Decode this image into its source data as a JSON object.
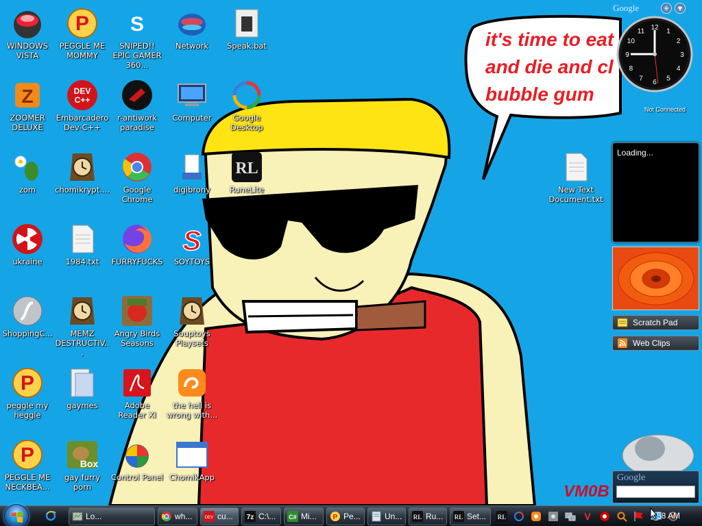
{
  "desktop_icons": [
    {
      "id": "windows-vista",
      "label": "WINDOWS VISTA",
      "icon": "vista-orb-icon"
    },
    {
      "id": "peggle-me-mommy",
      "label": "PEGGLE ME MOMMY",
      "icon": "peggle-icon"
    },
    {
      "id": "sniped",
      "label": "SNIPED!! EPIC GAMER 360...",
      "icon": "skype-icon"
    },
    {
      "id": "network",
      "label": "Network",
      "icon": "network-icon"
    },
    {
      "id": "speak-bat",
      "label": "Speak.bat",
      "icon": "batch-file-icon"
    },
    {
      "id": "zoomer-deluxe",
      "label": "ZOOMER DELUXE",
      "icon": "zoomer-icon"
    },
    {
      "id": "embarcadero",
      "label": "Embarcadero Dev-C++",
      "icon": "devcpp-icon"
    },
    {
      "id": "r-antiwork",
      "label": "r-antiwork paradise",
      "icon": "antiwork-icon"
    },
    {
      "id": "computer",
      "label": "Computer",
      "icon": "computer-icon"
    },
    {
      "id": "google-desktop",
      "label": "Google Desktop",
      "icon": "google-desktop-icon"
    },
    {
      "id": "zom",
      "label": "zom",
      "icon": "plant-icon"
    },
    {
      "id": "chomikrypt",
      "label": "chomikrypt....",
      "icon": "clock-app-icon"
    },
    {
      "id": "google-chrome",
      "label": "Google Chrome",
      "icon": "chrome-icon"
    },
    {
      "id": "digibrony",
      "label": "digibrony",
      "icon": "installer-icon"
    },
    {
      "id": "runelite",
      "label": "RuneLite",
      "icon": "runelite-icon"
    },
    {
      "id": "new-text-document",
      "label": "New Text Document.txt",
      "icon": "text-file-icon"
    },
    {
      "id": "ukraine",
      "label": "ukraine",
      "icon": "radiation-icon"
    },
    {
      "id": "1984-txt",
      "label": "1984.txt",
      "icon": "text-file-icon"
    },
    {
      "id": "furryfucks",
      "label": "FURRYFUCKS",
      "icon": "firefox-icon"
    },
    {
      "id": "soytoys",
      "label": "SOYTOYS",
      "icon": "soytoys-icon"
    },
    {
      "id": "shoppingc",
      "label": "ShoppingC...",
      "icon": "flash-icon"
    },
    {
      "id": "memz",
      "label": "MEMZ DESTRUCTIV...",
      "icon": "clock-app-icon"
    },
    {
      "id": "angry-birds",
      "label": "Angry Birds Seasons",
      "icon": "angry-birds-icon"
    },
    {
      "id": "souptoys",
      "label": "Souptoys Playsets",
      "icon": "clock-app-icon"
    },
    {
      "id": "peggle-my-heggle",
      "label": "peggle my heggle",
      "icon": "peggle-icon"
    },
    {
      "id": "gaymes",
      "label": "gaymes",
      "icon": "games-folder-icon"
    },
    {
      "id": "adobe-reader",
      "label": "Adobe Reader XI",
      "icon": "adobe-reader-icon"
    },
    {
      "id": "the-hell",
      "label": "the hell is wrong with...",
      "icon": "uc-browser-icon"
    },
    {
      "id": "peggle-me-neckbeard",
      "label": "PEGGLE ME NECKBEA...",
      "icon": "peggle-icon"
    },
    {
      "id": "gay-furry-porn",
      "label": "gay furry porn",
      "icon": "box-icon"
    },
    {
      "id": "control-panel",
      "label": "Control Panel",
      "icon": "control-panel-icon"
    },
    {
      "id": "chomikapp",
      "label": "ChomikApp",
      "icon": "window-app-icon"
    }
  ],
  "wallpaper": {
    "speech_lines": [
      "it's time to eat",
      "and die and cl",
      "bubble gum"
    ]
  },
  "gadgets": {
    "brand": "Google",
    "add_button": "+",
    "menu_button": "▾",
    "not_connected": "Not Connected",
    "clock_numbers": [
      "12",
      "1",
      "2",
      "3",
      "4",
      "5",
      "6",
      "7",
      "8",
      "9",
      "10",
      "11"
    ],
    "loading": "Loading...",
    "scratch_pad": "Scratch Pad",
    "web_clips": "Web Clips",
    "search_brand": "Google",
    "search_value": ""
  },
  "watermark": "VM0B",
  "taskbar": {
    "quick_launch": [
      "internet-explorer-icon",
      "media-player-icon",
      "uc-browser-icon"
    ],
    "tasks": [
      {
        "label": "Lo...",
        "icon": "taskmgr-icon"
      },
      {
        "label": "wh...",
        "icon": "chrome-icon"
      },
      {
        "label": "cu...",
        "icon": "devcpp-icon",
        "active": true
      },
      {
        "label": "C:\\...",
        "icon": "7zip-icon"
      },
      {
        "label": "Mi...",
        "icon": "csharp-icon"
      },
      {
        "label": "Pe...",
        "icon": "peggle-icon"
      },
      {
        "label": "Un...",
        "icon": "notepad-icon"
      },
      {
        "label": "Ru...",
        "icon": "runelite-icon"
      },
      {
        "label": "Set...",
        "icon": "runelite-icon"
      }
    ],
    "tray": [
      "runelite-icon",
      "google-desktop-icon",
      "uc-browser-icon",
      "settings-icon",
      "network-tray-icon",
      "vivaldi-icon",
      "bittorrent-icon",
      "search-tray-icon",
      "flag-icon",
      "display-icon",
      "webcam-icon"
    ],
    "clock": "58 AM"
  }
}
